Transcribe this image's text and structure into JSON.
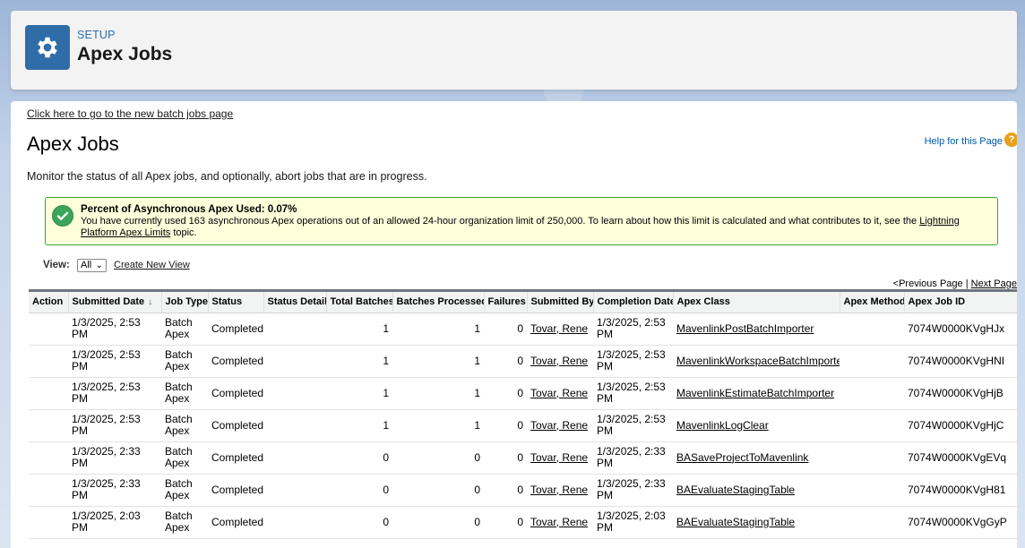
{
  "header": {
    "eyebrow": "SETUP",
    "title": "Apex Jobs",
    "icon": "gear-icon"
  },
  "page": {
    "new_batch_link": "Click here to go to the new batch jobs page",
    "title": "Apex Jobs",
    "help_link": "Help for this Page",
    "description": "Monitor the status of all Apex jobs, and optionally, abort jobs that are in progress."
  },
  "alert": {
    "title": "Percent of Asynchronous Apex Used: 0.07%",
    "text_before": "You have currently used 163 asynchronous Apex operations out of an allowed 24-hour organization limit of 250,000. To learn about how this limit is calculated and what contributes to it, see the ",
    "link": "Lightning Platform Apex Limits",
    "text_after": " topic."
  },
  "view": {
    "label": "View:",
    "selected": "All",
    "create_link": "Create New View"
  },
  "pager": {
    "prev": "<Previous Page",
    "separator": " | ",
    "next": "Next Page"
  },
  "table": {
    "columns": [
      "Action",
      "Submitted Date",
      "Job Type",
      "Status",
      "Status Detail",
      "Total Batches",
      "Batches Processed",
      "Failures",
      "Submitted By",
      "Completion Date",
      "Apex Class",
      "Apex Method",
      "Apex Job ID"
    ],
    "rows": [
      {
        "action": "",
        "submitted": "1/3/2025, 2:53 PM",
        "type_line1": "Batch",
        "type_line2": "Apex",
        "status": "Completed",
        "detail": "",
        "total": "1",
        "processed": "1",
        "failures": "0",
        "by": "Tovar, Rene",
        "completed_line1": "1/3/2025, 2:53",
        "completed_line2": "PM",
        "class": "MavenlinkPostBatchImporter",
        "method": "",
        "job_id": "7074W0000KVgHJx"
      },
      {
        "action": "",
        "submitted": "1/3/2025, 2:53 PM",
        "type_line1": "Batch",
        "type_line2": "Apex",
        "status": "Completed",
        "detail": "",
        "total": "1",
        "processed": "1",
        "failures": "0",
        "by": "Tovar, Rene",
        "completed_line1": "1/3/2025, 2:53",
        "completed_line2": "PM",
        "class": "MavenlinkWorkspaceBatchImporter",
        "method": "",
        "job_id": "7074W0000KVgHNI"
      },
      {
        "action": "",
        "submitted": "1/3/2025, 2:53 PM",
        "type_line1": "Batch",
        "type_line2": "Apex",
        "status": "Completed",
        "detail": "",
        "total": "1",
        "processed": "1",
        "failures": "0",
        "by": "Tovar, Rene",
        "completed_line1": "1/3/2025, 2:53",
        "completed_line2": "PM",
        "class": "MavenlinkEstimateBatchImporter",
        "method": "",
        "job_id": "7074W0000KVgHjB"
      },
      {
        "action": "",
        "submitted": "1/3/2025, 2:53 PM",
        "type_line1": "Batch",
        "type_line2": "Apex",
        "status": "Completed",
        "detail": "",
        "total": "1",
        "processed": "1",
        "failures": "0",
        "by": "Tovar, Rene",
        "completed_line1": "1/3/2025, 2:53",
        "completed_line2": "PM",
        "class": "MavenlinkLogClear",
        "method": "",
        "job_id": "7074W0000KVgHjC"
      },
      {
        "action": "",
        "submitted": "1/3/2025, 2:33 PM",
        "type_line1": "Batch",
        "type_line2": "Apex",
        "status": "Completed",
        "detail": "",
        "total": "0",
        "processed": "0",
        "failures": "0",
        "by": "Tovar, Rene",
        "completed_line1": "1/3/2025, 2:33",
        "completed_line2": "PM",
        "class": "BASaveProjectToMavenlink",
        "method": "",
        "job_id": "7074W0000KVgEVq"
      },
      {
        "action": "",
        "submitted": "1/3/2025, 2:33 PM",
        "type_line1": "Batch",
        "type_line2": "Apex",
        "status": "Completed",
        "detail": "",
        "total": "0",
        "processed": "0",
        "failures": "0",
        "by": "Tovar, Rene",
        "completed_line1": "1/3/2025, 2:33",
        "completed_line2": "PM",
        "class": "BAEvaluateStagingTable",
        "method": "",
        "job_id": "7074W0000KVgH81"
      },
      {
        "action": "",
        "submitted": "1/3/2025, 2:03 PM",
        "type_line1": "Batch",
        "type_line2": "Apex",
        "status": "Completed",
        "detail": "",
        "total": "0",
        "processed": "0",
        "failures": "0",
        "by": "Tovar, Rene",
        "completed_line1": "1/3/2025, 2:03",
        "completed_line2": "PM",
        "class": "BAEvaluateStagingTable",
        "method": "",
        "job_id": "7074W0000KVgGyP"
      }
    ]
  }
}
